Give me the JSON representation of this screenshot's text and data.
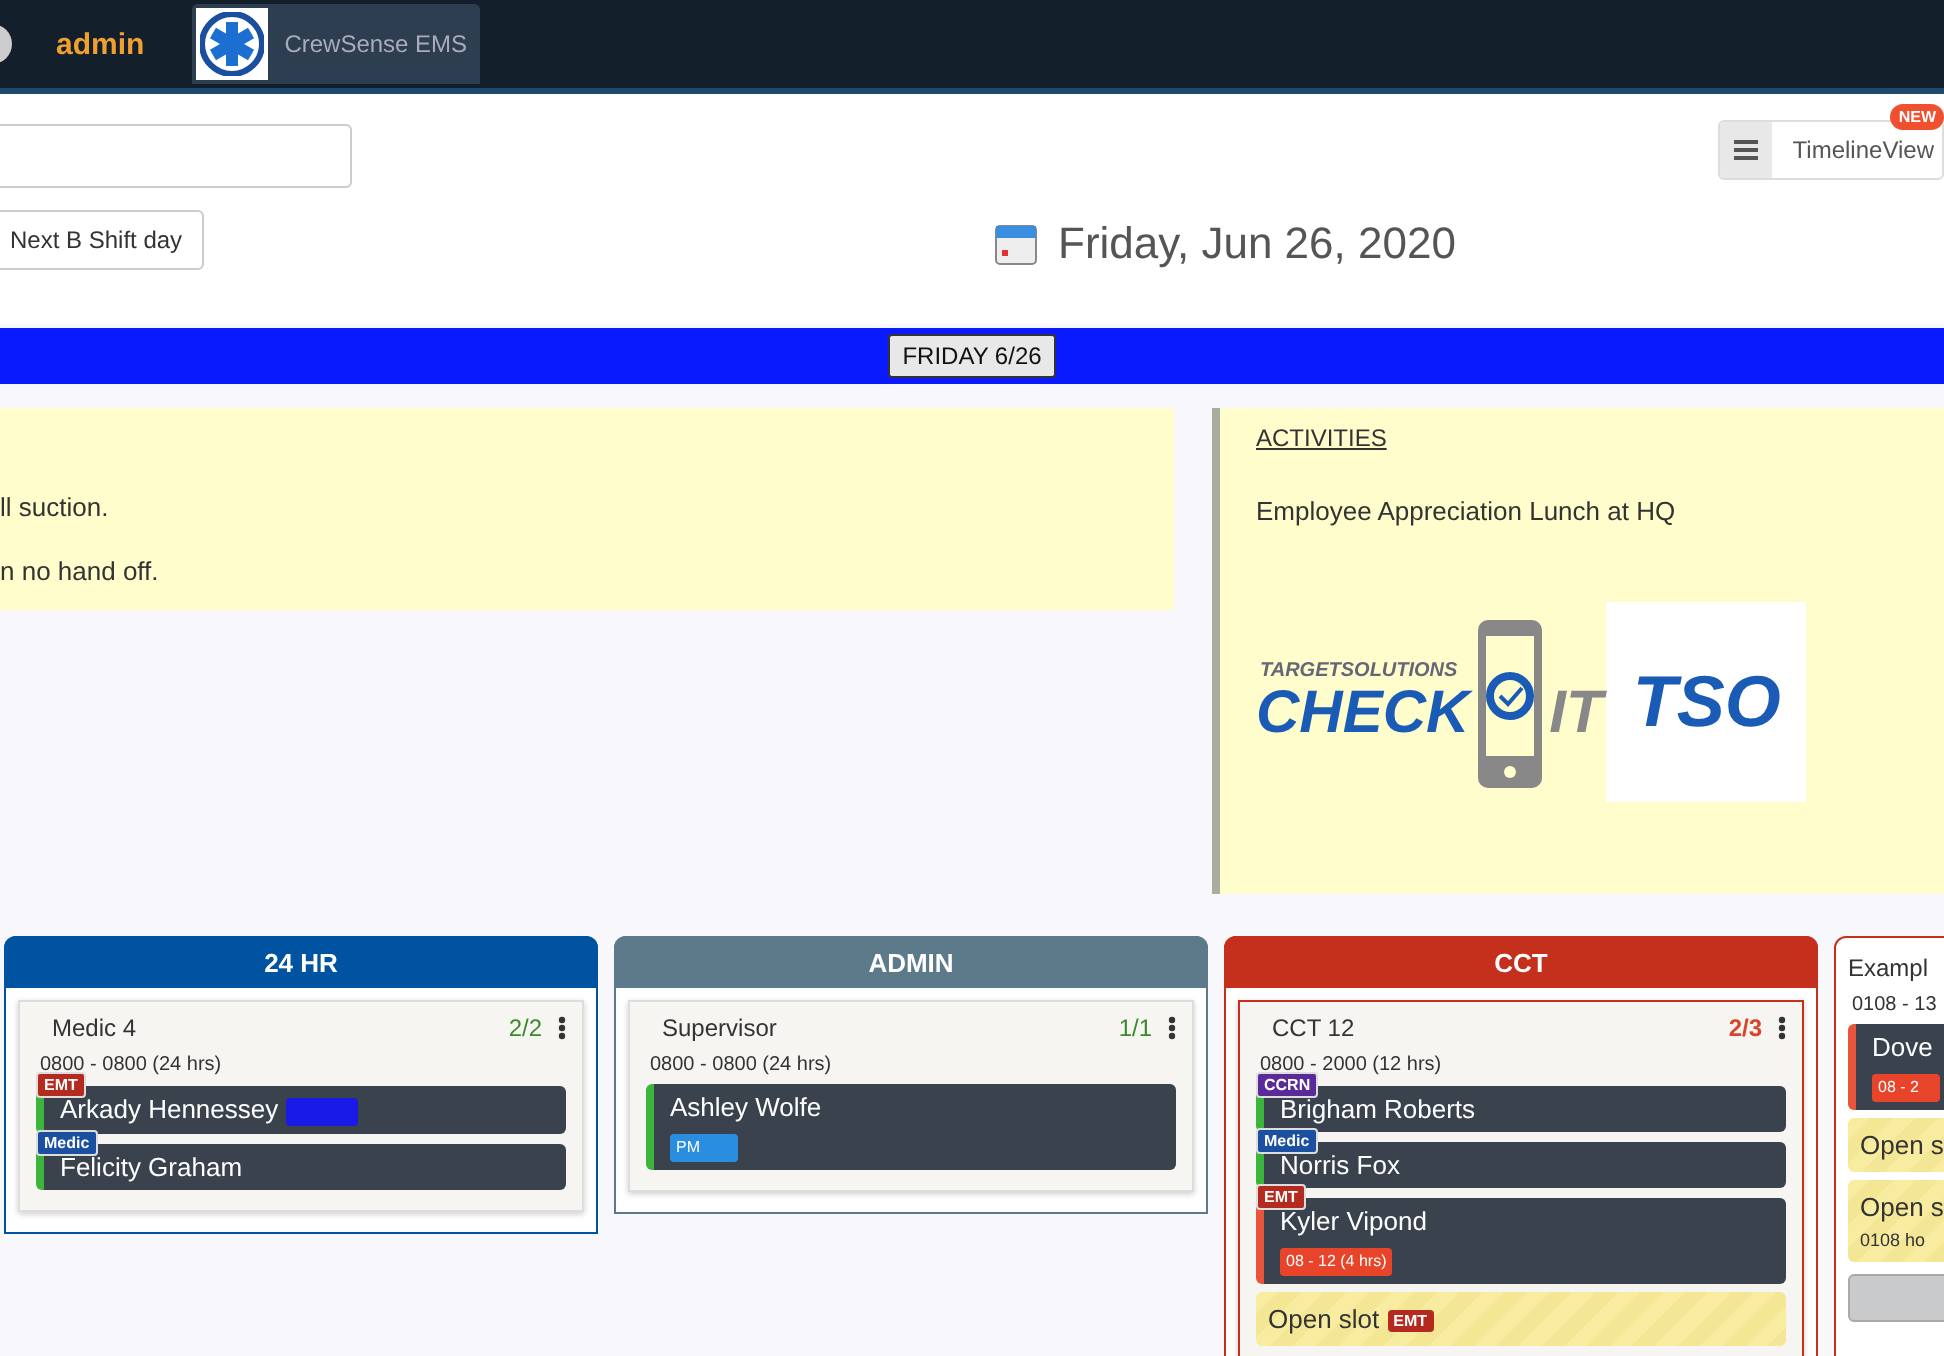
{
  "navbar": {
    "brand": "admin",
    "tab": {
      "label": "CrewSense EMS",
      "selected": true
    }
  },
  "toolbar": {
    "next_button": "Next B Shift day",
    "view_toggle": {
      "label": "TimelineView",
      "badge": "NEW"
    },
    "date": "Friday, Jun 26, 2020"
  },
  "day_bar": {
    "label": "FRIDAY 6/26"
  },
  "notes": {
    "lines": [
      "ll suction.",
      "n no hand off."
    ]
  },
  "activities": {
    "heading": "ACTIVITIES",
    "items": [
      "Employee Appreciation Lunch at HQ"
    ],
    "logo": {
      "tagline": "TARGETSOLUTIONS",
      "word_1": "CHECK",
      "word_2": "IT",
      "mark": "TSO"
    }
  },
  "columns": [
    {
      "title": "24 HR",
      "color": "#0053a0",
      "cards": [
        {
          "title": "Medic 4",
          "count": "2/2",
          "short": false,
          "time": "0800 - 0800 (24 hrs)",
          "slots": [
            {
              "kind": "crew",
              "name": "Arkady Hennessey",
              "color": "#3cb53c",
              "role": {
                "label": "EMT",
                "color": "#b52a1e"
              },
              "chip": {
                "color": "#1a1ae6"
              }
            },
            {
              "kind": "crew",
              "name": "Felicity Graham",
              "color": "#3cb53c",
              "role": {
                "label": "Medic",
                "color": "#1b4fa0"
              }
            }
          ]
        }
      ]
    },
    {
      "title": "ADMIN",
      "color": "#5d7a8a",
      "cards": [
        {
          "title": "Supervisor",
          "count": "1/1",
          "short": false,
          "time": "0800 - 0800 (24 hrs)",
          "slots": [
            {
              "kind": "crew",
              "name": "Ashley Wolfe",
              "color": "#3cb53c",
              "chip": {
                "label": "PM",
                "color": "#2a8ee0"
              }
            }
          ]
        }
      ]
    },
    {
      "title": "CCT",
      "color": "#c4301c",
      "cards": [
        {
          "title": "CCT 12",
          "count": "2/3",
          "short": true,
          "time": "0800 - 2000 (12 hrs)",
          "slots": [
            {
              "kind": "crew",
              "name": "Brigham Roberts",
              "color": "#3cb53c",
              "role": {
                "label": "CCRN",
                "color": "#5a2a9a"
              }
            },
            {
              "kind": "crew",
              "name": "Norris Fox",
              "color": "#3cb53c",
              "role": {
                "label": "Medic",
                "color": "#1b4fa0"
              }
            },
            {
              "kind": "crew",
              "name": "Kyler Vipond",
              "color": "#e8553a",
              "role": {
                "label": "EMT",
                "color": "#b52a1e"
              },
              "chip": {
                "label": "08 - 12 (4 hrs)",
                "color": "#e8442a"
              }
            },
            {
              "kind": "open",
              "label": "Open slot",
              "role": {
                "label": "EMT",
                "color": "#b52a1e"
              }
            }
          ]
        }
      ]
    },
    {
      "color": "#c4301c",
      "cards": [
        {
          "title": "Exampl",
          "time": "0108 - 13",
          "slots": [
            {
              "kind": "crew",
              "name": "Dove",
              "color": "#e8553a",
              "chip": {
                "label": "08 - 2",
                "color": "#e8442a"
              }
            },
            {
              "kind": "open",
              "label": "Open s"
            },
            {
              "kind": "open",
              "label": "Open s",
              "hours": "0108 ho"
            },
            {
              "kind": "action"
            }
          ]
        }
      ]
    }
  ]
}
